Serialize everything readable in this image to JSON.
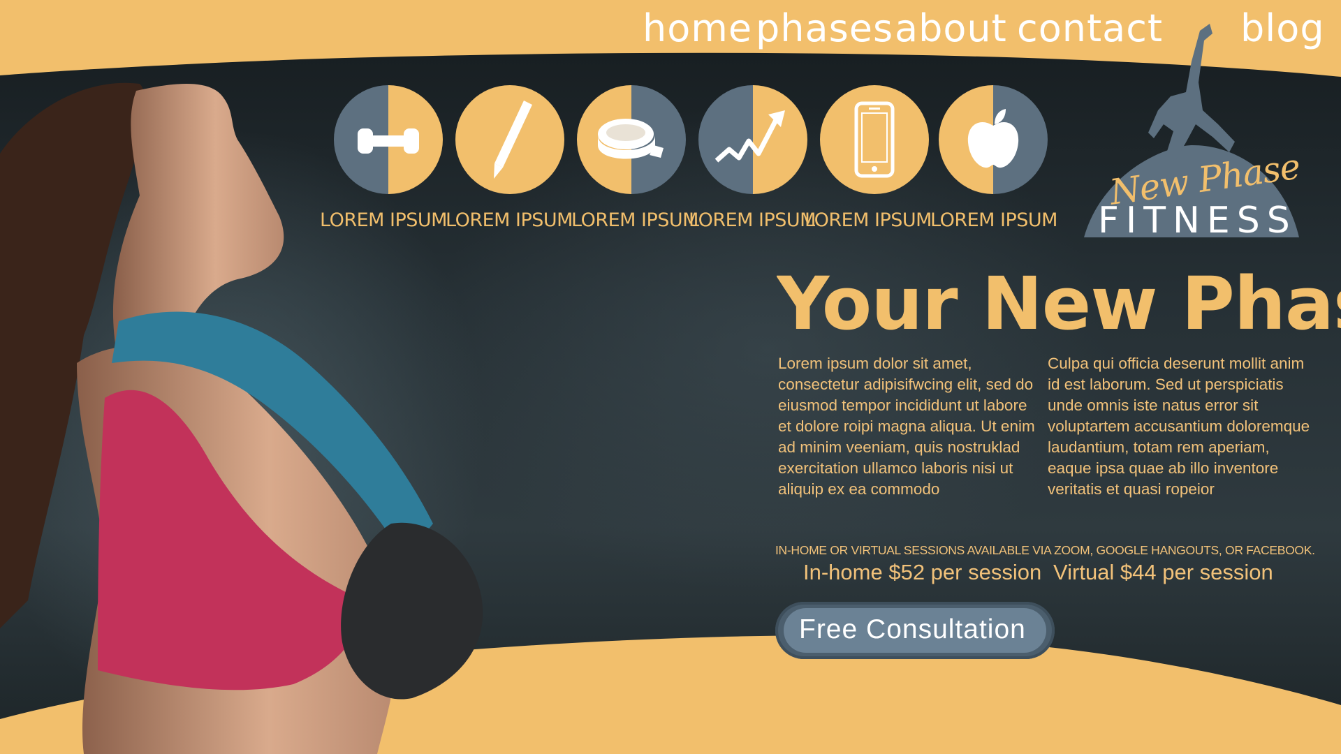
{
  "nav": {
    "items": [
      {
        "id": "home",
        "label": "home"
      },
      {
        "id": "phases",
        "label": "phases"
      },
      {
        "id": "about",
        "label": "about"
      },
      {
        "id": "contact",
        "label": "contact"
      },
      {
        "id": "blog",
        "label": "blog"
      }
    ]
  },
  "features": [
    {
      "icon": "dumbbell-icon",
      "label": "LOREM IPSUM"
    },
    {
      "icon": "pencil-icon",
      "label": "LOREM IPSUM"
    },
    {
      "icon": "measuring-tape-icon",
      "label": "LOREM IPSUM"
    },
    {
      "icon": "trend-arrow-icon",
      "label": "LOREM IPSUM"
    },
    {
      "icon": "smartphone-icon",
      "label": "LOREM IPSUM"
    },
    {
      "icon": "apple-icon",
      "label": "LOREM IPSUM"
    }
  ],
  "logo": {
    "script": "New Phase",
    "word": "FITNESS"
  },
  "hero": {
    "headline": "Your New Phase o",
    "paragraph_left": "Lorem ipsum dolor sit amet, consectetur adipisifwcing elit, sed do eiusmod tempor incididunt ut labore et dolore roipi magna aliqua. Ut enim ad minim veeniam, quis nostruklad exercitation ullamco laboris nisi ut aliquip ex ea commodo",
    "paragraph_right": "Culpa qui officia deserunt mollit anim id est laborum. Sed ut perspiciatis unde omnis iste natus error sit voluptartem accusantium doloremque laudantium, totam rem aperiam, eaque ipsa quae ab illo inventore veritatis et quasi ropeior",
    "sessions_note": "IN-HOME OR VIRTUAL SESSIONS AVAILABLE VIA ZOOM, GOOGLE HANGOUTS, OR FACEBOOK.",
    "price_inhome": "In-home $52 per session",
    "price_virtual": "Virtual $44 per session",
    "cta_label": "Free Consultation"
  },
  "colors": {
    "accent": "#f2bf6c",
    "slate": "#5d7080",
    "background": "#1f272b",
    "white": "#ffffff"
  }
}
